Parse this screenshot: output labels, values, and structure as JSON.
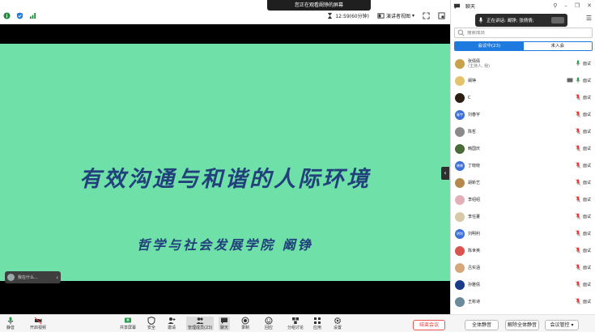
{
  "screen_share_notice": "您正在观看阚铮的屏幕",
  "topbar": {
    "duration": "12:59(60分钟)",
    "view_mode": "演讲者视图"
  },
  "slide": {
    "title": "有效沟通与和谐的人际环境",
    "subtitle": "哲学与社会发展学院 阚铮"
  },
  "caption_pill": {
    "text": "我在什么..."
  },
  "panel": {
    "chat_label": "聊天",
    "speaking_text": "正在讲话: 阚铮; 张倩倩;",
    "search_placeholder": "搜索成员",
    "tab_in_meeting": "会议中(23)",
    "tab_not_joined": "未入会",
    "participants": [
      {
        "name": "张倩倩",
        "role": "(主持人, 我)",
        "color": "#c8a24a",
        "initials": "",
        "mic": "on"
      },
      {
        "name": "阚铮",
        "role": "",
        "color": "#e3c36c",
        "initials": "",
        "mic": "on",
        "screen": true
      },
      {
        "name": "C",
        "role": "",
        "color": "#2c1f12",
        "initials": "",
        "mic": "off"
      },
      {
        "name": "刘春宇",
        "role": "",
        "color": "#3d6fd6",
        "initials": "春宇",
        "mic": "off"
      },
      {
        "name": "陈哲",
        "role": "",
        "color": "#8a8a8a",
        "initials": "",
        "mic": "off"
      },
      {
        "name": "韩国庆",
        "role": "",
        "color": "#4a6a3a",
        "initials": "",
        "mic": "off"
      },
      {
        "name": "丁晓晓",
        "role": "",
        "color": "#3d6fd6",
        "initials": "晓晓",
        "mic": "off"
      },
      {
        "name": "胡新艺",
        "role": "",
        "color": "#b4894a",
        "initials": "",
        "mic": "off"
      },
      {
        "name": "李绍绍",
        "role": "",
        "color": "#e4b0b8",
        "initials": "",
        "mic": "off"
      },
      {
        "name": "李任董",
        "role": "",
        "color": "#d8c9a8",
        "initials": "",
        "mic": "off"
      },
      {
        "name": "刘明利",
        "role": "",
        "color": "#3d6fd6",
        "initials": "明利",
        "mic": "off"
      },
      {
        "name": "陈世英",
        "role": "",
        "color": "#d9534f",
        "initials": "",
        "mic": "off"
      },
      {
        "name": "吕实涵",
        "role": "",
        "color": "#d6a77a",
        "initials": "",
        "mic": "off"
      },
      {
        "name": "孙雅倩",
        "role": "",
        "color": "#1a3c88",
        "initials": "",
        "mic": "off"
      },
      {
        "name": "王彬诗",
        "role": "",
        "color": "#6a8a9a",
        "initials": "",
        "mic": "off"
      }
    ],
    "action_label": "面试"
  },
  "toolbar": {
    "mute": "静音",
    "video": "开启视频",
    "share": "共享屏幕",
    "security": "安全",
    "invite": "邀请",
    "participants": "管理成员(23)",
    "chat": "聊天",
    "record": "录制",
    "reactions": "回应",
    "breakout": "分组讨论",
    "apps": "应用",
    "settings": "设置",
    "end_meeting": "结束会议",
    "mute_all": "全体静音",
    "unmute_all": "解除全体静音",
    "meeting_control": "会议管控"
  }
}
